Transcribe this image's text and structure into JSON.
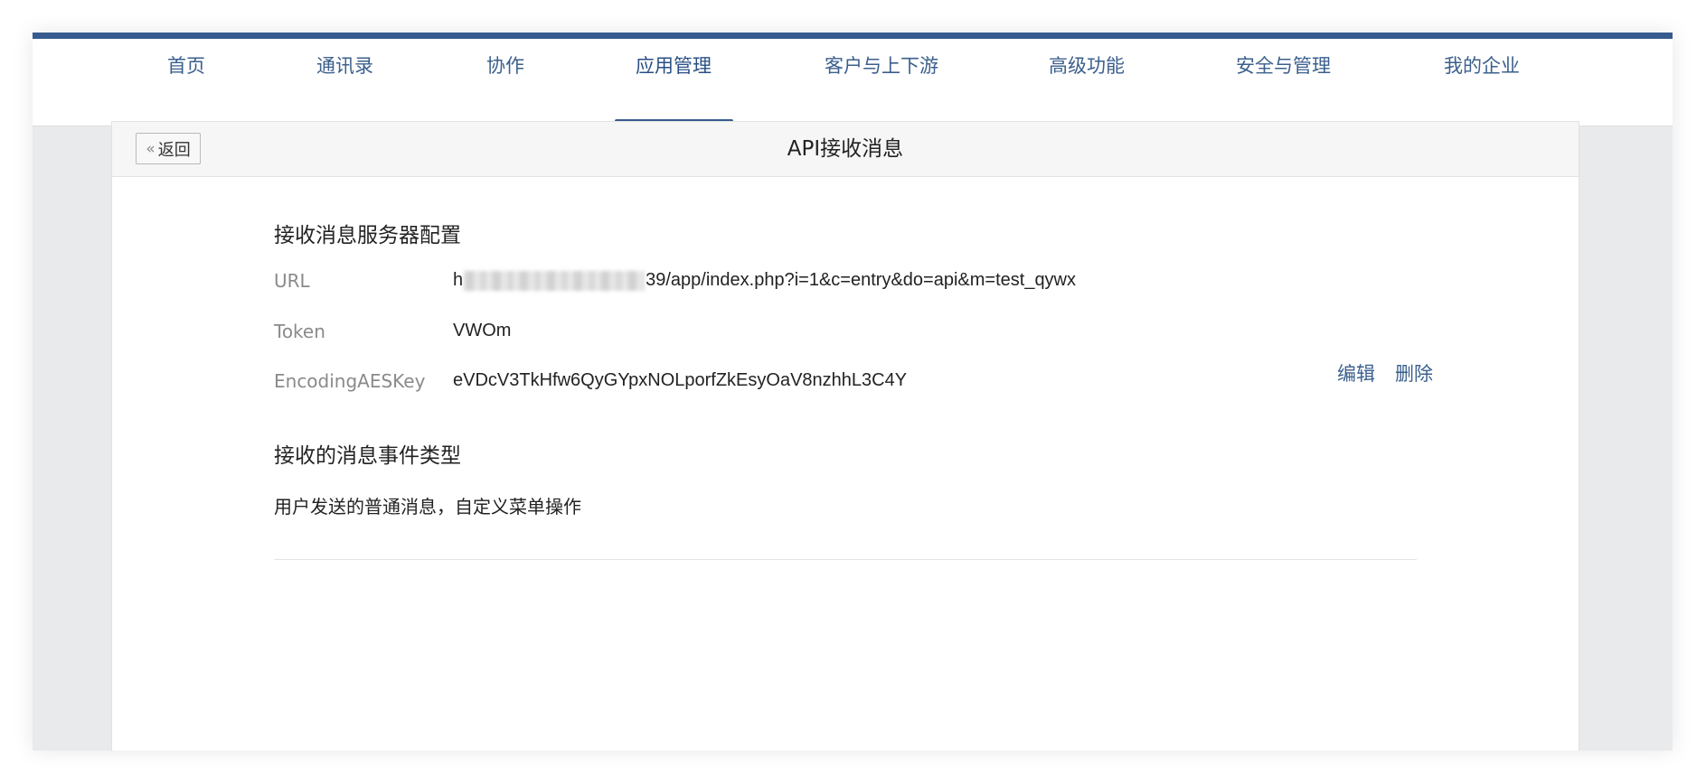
{
  "nav": {
    "items": [
      {
        "label": "首页"
      },
      {
        "label": "通讯录"
      },
      {
        "label": "协作"
      },
      {
        "label": "应用管理",
        "active": true
      },
      {
        "label": "客户与上下游"
      },
      {
        "label": "高级功能"
      },
      {
        "label": "安全与管理"
      },
      {
        "label": "我的企业"
      }
    ]
  },
  "card": {
    "back_label": "返回",
    "back_icon": "double-chevron-left-icon",
    "title": "API接收消息"
  },
  "server_config": {
    "section_title": "接收消息服务器配置",
    "url_label": "URL",
    "url_prefix": "h",
    "url_suffix": "39/app/index.php?i=1&c=entry&do=api&m=test_qywx",
    "token_label": "Token",
    "token_value": "VWOm",
    "aes_label": "EncodingAESKey",
    "aes_value": "eVDcV3TkHfw6QyGYpxNOLporfZkEsyOaV8nzhhL3C4Y",
    "edit_label": "编辑",
    "delete_label": "删除"
  },
  "events": {
    "section_title": "接收的消息事件类型",
    "description": "用户发送的普通消息，自定义菜单操作"
  },
  "colors": {
    "accent": "#365b8e",
    "link": "#3b5f8c"
  }
}
